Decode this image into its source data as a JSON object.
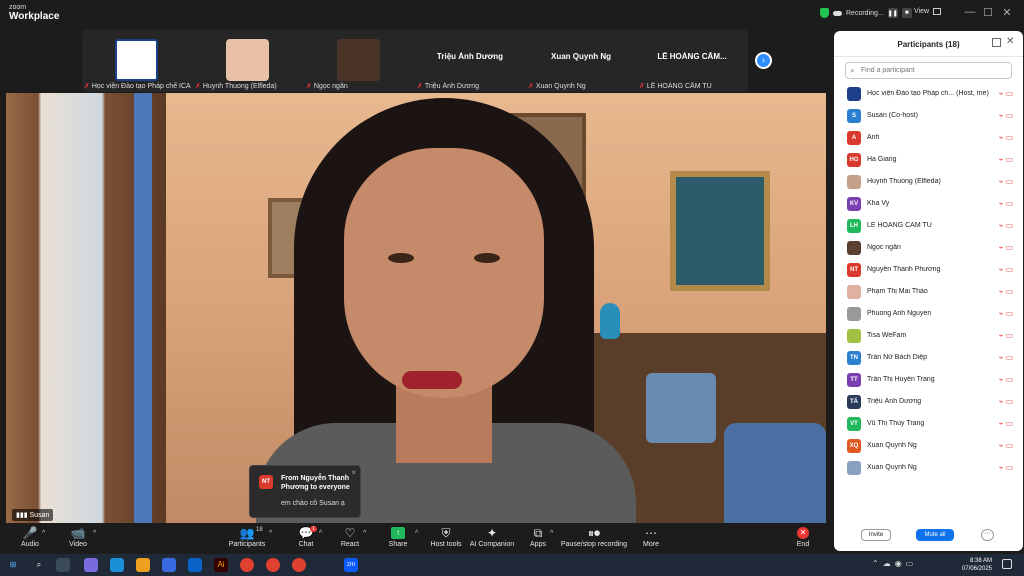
{
  "app": {
    "brand_line1": "zoom",
    "brand_line2": "Workplace"
  },
  "titlebar": {
    "recording_label": "Recording...",
    "view_label": "View",
    "pause_glyph": "❚❚",
    "stop_glyph": "■",
    "min": "—",
    "max": "☐",
    "close": "✕"
  },
  "strip": {
    "tiles": [
      {
        "label": "Học viện Đào tạo Pháp chế ICA",
        "name": ""
      },
      {
        "label": "Huynh Thuong (Elfleda)",
        "name": ""
      },
      {
        "label": "Ngọc ngân",
        "name": ""
      },
      {
        "label": "Triệu Ánh Dương",
        "name": "Triệu Ánh Dương"
      },
      {
        "label": "Xuan Quynh Ng",
        "name": "Xuan Quynh Ng"
      },
      {
        "label": "LÊ HOÀNG CẨM TÚ",
        "name": "LÊ HOÀNG CẨM..."
      }
    ],
    "next_glyph": "›",
    "mic_glyph": "✗"
  },
  "video": {
    "speaker_name": "Susan",
    "signal_glyph": "▮▮▮"
  },
  "chat_toast": {
    "avatar": "NT",
    "from": "From Nguyễn Thanh Phương to everyone",
    "message": "em chào cô Susan ạ",
    "close": "×"
  },
  "toolbar": {
    "audio": "Audio",
    "video": "Video",
    "participants": "Participants",
    "participants_count": "18",
    "chat": "Chat",
    "chat_badge": "1",
    "react": "React",
    "share": "Share",
    "host_tools": "Host tools",
    "ai_companion": "AI Companion",
    "apps": "Apps",
    "pause_recording": "Pause/stop recording",
    "more": "More",
    "end": "End",
    "icons": {
      "audio": "🎤",
      "video": "📹",
      "participants": "👥",
      "chat": "💬",
      "react": "♡",
      "share": "↑",
      "host_tools": "⛨",
      "ai": "✦",
      "apps": "⧉",
      "pause": "⏸⏺",
      "more": "⋯",
      "end": "✕",
      "caret": "^"
    }
  },
  "panel": {
    "title": "Participants (18)",
    "search_placeholder": "Find a participant",
    "invite": "Invite",
    "mute_all": "Mute all",
    "more": "···",
    "participants": [
      {
        "initials": "",
        "name": "Học viện Đào tạo Pháp ch...  (Host, me)",
        "color": "#1e3f8a"
      },
      {
        "initials": "S",
        "name": "Susan (Co-host)",
        "color": "#2d7fd0"
      },
      {
        "initials": "A",
        "name": "Ánh",
        "color": "#d93a2c"
      },
      {
        "initials": "HG",
        "name": "Ha Giang",
        "color": "#d93a2c"
      },
      {
        "initials": "",
        "name": "Huynh Thuong (Elfleda)",
        "color": "#c4a28a"
      },
      {
        "initials": "KV",
        "name": "Kha Vy",
        "color": "#7a3fb0"
      },
      {
        "initials": "LH",
        "name": "LÊ HOÀNG CẨM TÚ",
        "color": "#1fb85c"
      },
      {
        "initials": "",
        "name": "Ngọc ngân",
        "color": "#5a4030"
      },
      {
        "initials": "NT",
        "name": "Nguyễn Thanh Phương",
        "color": "#d93a2c"
      },
      {
        "initials": "",
        "name": "Phạm Thị Mai Thảo",
        "color": "#e0b0a0"
      },
      {
        "initials": "",
        "name": "Phuong Anh Nguyen",
        "color": "#999999"
      },
      {
        "initials": "",
        "name": "Tisa WeFam",
        "color": "#a0c040"
      },
      {
        "initials": "TN",
        "name": "Trần Nữ Bách Diệp",
        "color": "#2d7fd0"
      },
      {
        "initials": "TT",
        "name": "Trần Thị Huyền Trang",
        "color": "#7a3fb0"
      },
      {
        "initials": "TÁ",
        "name": "Triệu Ánh Dương",
        "color": "#2a3a5a"
      },
      {
        "initials": "VT",
        "name": "Vũ Thị Thùy Trang",
        "color": "#1fb85c"
      },
      {
        "initials": "XQ",
        "name": "Xuan Quynh Ng",
        "color": "#e05a20"
      },
      {
        "initials": "",
        "name": "Xuan Quynh Ng",
        "color": "#8aa0c0"
      }
    ]
  },
  "taskbar": {
    "time": "8:38 AM",
    "date": "07/06/2025"
  }
}
